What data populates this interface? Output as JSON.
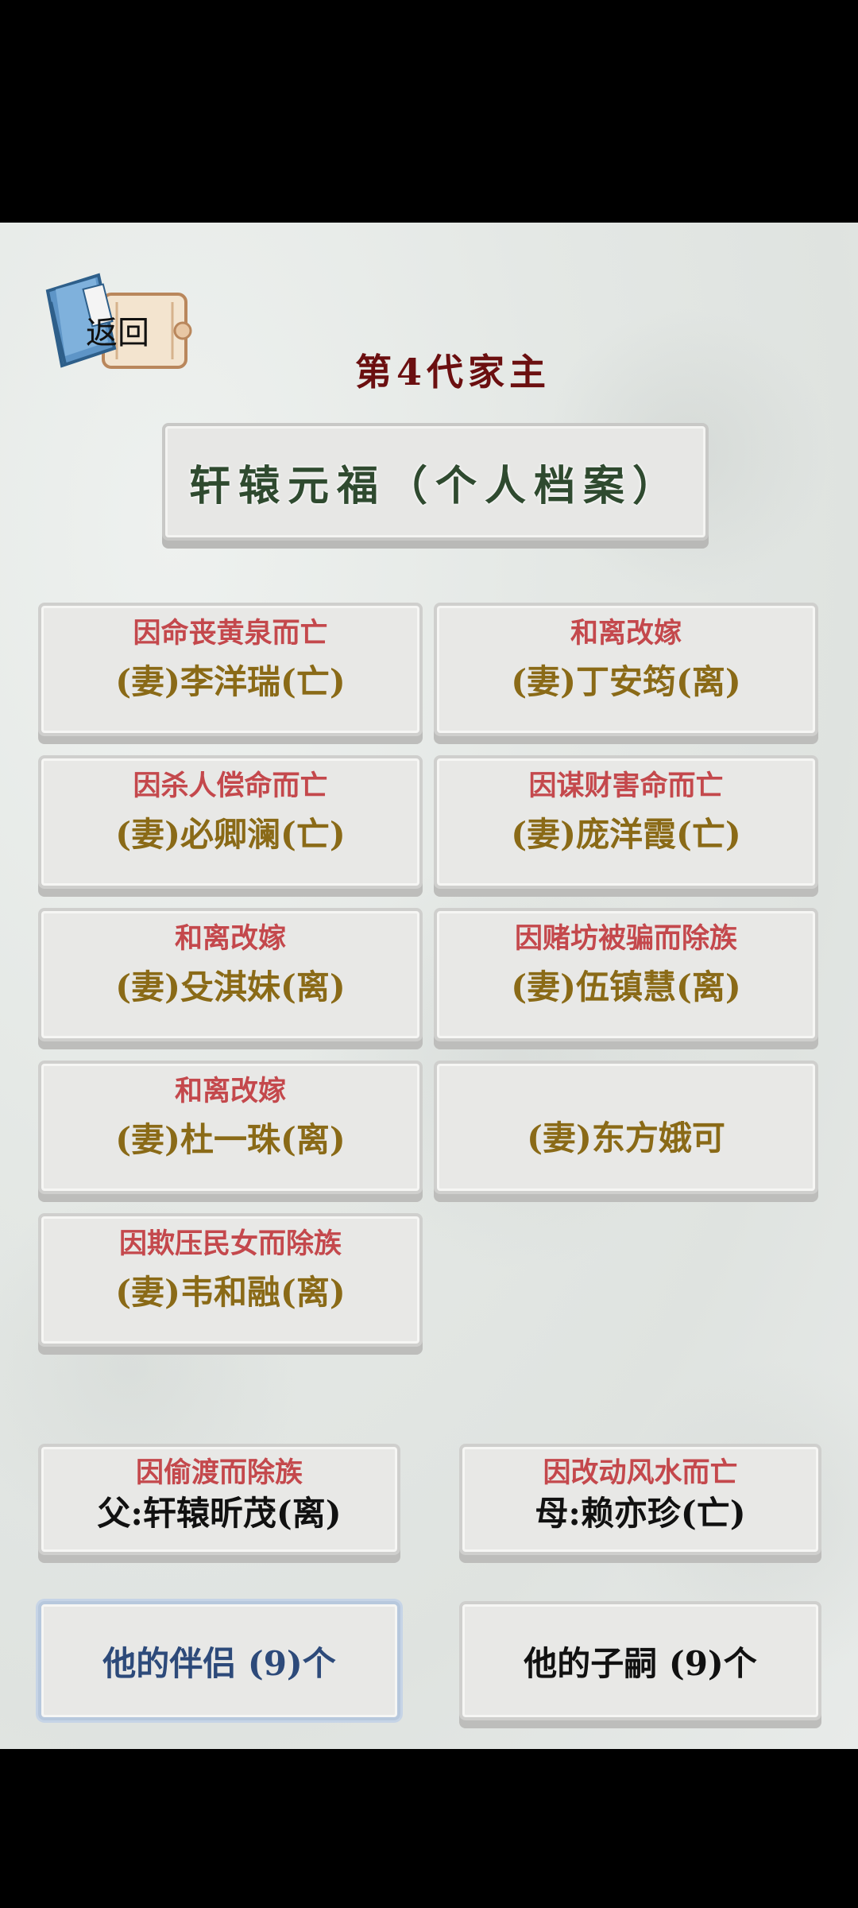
{
  "header": {
    "back_label": "返回",
    "generation_title": "第4代家主",
    "person_title": "轩辕元福（个人档案）"
  },
  "spouses": [
    {
      "status": "因命丧黄泉而亡",
      "name": "(妻)李洋瑞(亡)"
    },
    {
      "status": "和离改嫁",
      "name": "(妻)丁安筠(离)"
    },
    {
      "status": "因杀人偿命而亡",
      "name": "(妻)必卿澜(亡)"
    },
    {
      "status": "因谋财害命而亡",
      "name": "(妻)庞洋霞(亡)"
    },
    {
      "status": "和离改嫁",
      "name": "(妻)殳淇妹(离)"
    },
    {
      "status": "因赌坊被骗而除族",
      "name": "(妻)伍镇慧(离)"
    },
    {
      "status": "和离改嫁",
      "name": "(妻)杜一珠(离)"
    },
    {
      "status": "",
      "name": "(妻)东方娥可"
    },
    {
      "status": "因欺压民女而除族",
      "name": "(妻)韦和融(离)"
    }
  ],
  "parents": {
    "father": {
      "status": "因偷渡而除族",
      "name": "父:轩辕昕茂(离)"
    },
    "mother": {
      "status": "因改动风水而亡",
      "name": "母:赖亦珍(亡)"
    }
  },
  "tabs": {
    "partners": "他的伴侣 (9)个",
    "children": "他的子嗣 (9)个"
  },
  "colors": {
    "status_red": "#c4484c",
    "spouse_name_gold": "#8a6a17",
    "title_dark_red": "#6b0f10",
    "plate_green": "#2f4a2f",
    "active_tab_blue": "#2d4a7a"
  }
}
